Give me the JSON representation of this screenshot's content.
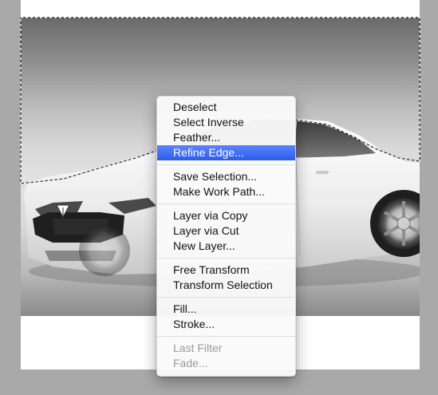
{
  "menu": {
    "groups": [
      [
        {
          "label": "Deselect",
          "enabled": true
        },
        {
          "label": "Select Inverse",
          "enabled": true
        },
        {
          "label": "Feather...",
          "enabled": true
        },
        {
          "label": "Refine Edge...",
          "enabled": true,
          "highlighted": true
        }
      ],
      [
        {
          "label": "Save Selection...",
          "enabled": true
        },
        {
          "label": "Make Work Path...",
          "enabled": true
        }
      ],
      [
        {
          "label": "Layer via Copy",
          "enabled": true
        },
        {
          "label": "Layer via Cut",
          "enabled": true
        },
        {
          "label": "New Layer...",
          "enabled": true
        }
      ],
      [
        {
          "label": "Free Transform",
          "enabled": true
        },
        {
          "label": "Transform Selection",
          "enabled": true
        }
      ],
      [
        {
          "label": "Fill...",
          "enabled": true
        },
        {
          "label": "Stroke...",
          "enabled": true
        }
      ],
      [
        {
          "label": "Last Filter",
          "enabled": false
        },
        {
          "label": "Fade...",
          "enabled": false
        }
      ]
    ]
  },
  "colors": {
    "workspace": "#a9a9a9",
    "highlight": "#2d5de6",
    "car_body": "#f2f2f2"
  },
  "icons": {
    "car_badge": "tesla-logo-icon"
  }
}
